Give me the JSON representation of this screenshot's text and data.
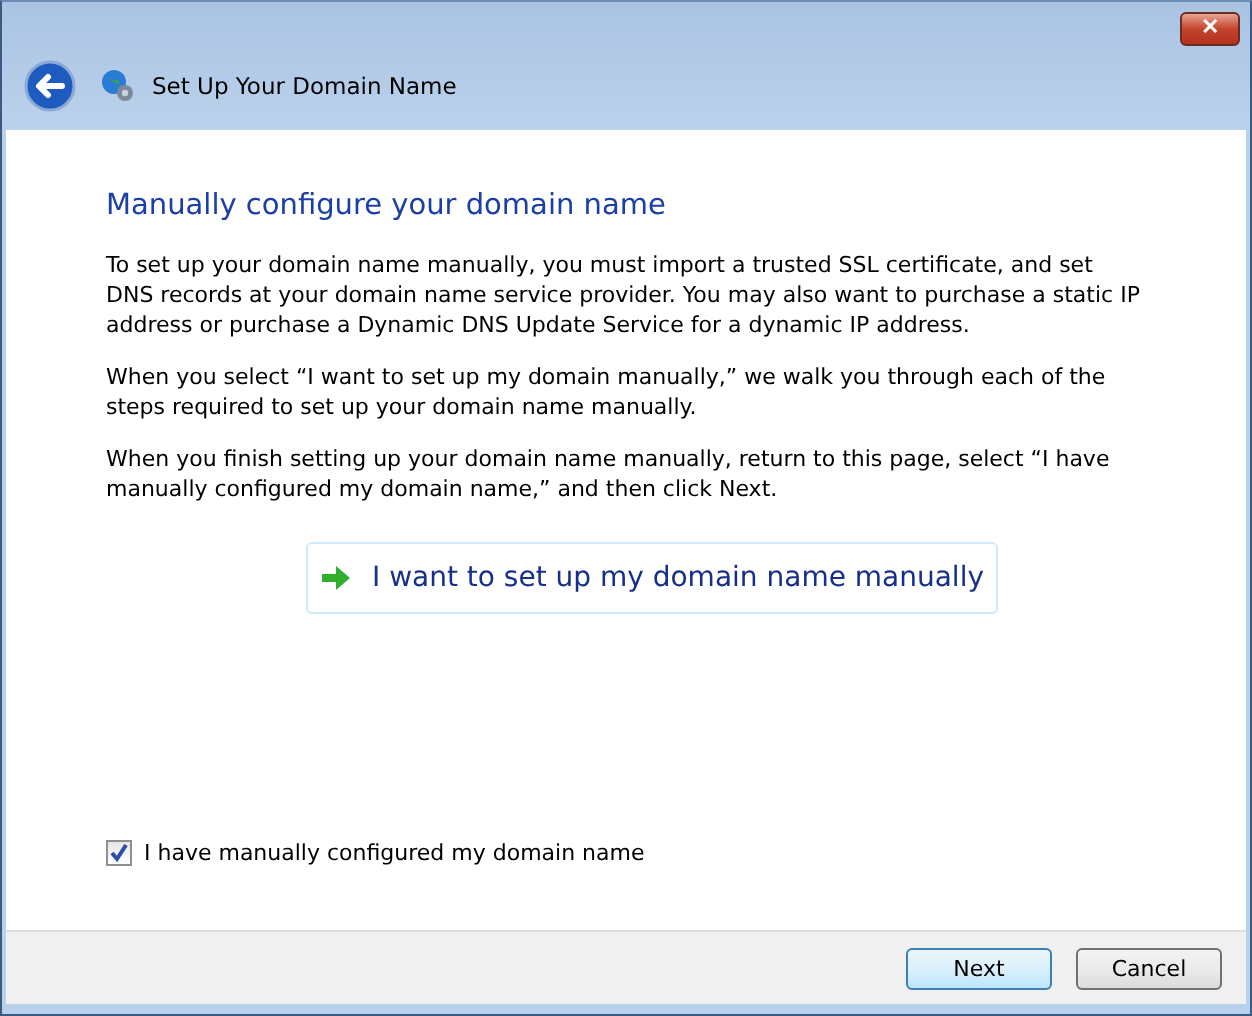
{
  "window": {
    "title": "Set Up Your Domain Name",
    "close_symbol": "✕"
  },
  "heading": "Manually configure your domain name",
  "paragraphs": [
    "To set up your domain name manually, you must import a trusted SSL certificate, and set DNS records at your domain name service provider. You may also want to purchase a static IP address or purchase a Dynamic DNS Update Service for a dynamic IP address.",
    "When you select “I want to set up my domain manually,” we walk you through each of the steps required to set up your domain name manually.",
    "When you finish setting up your domain name manually, return to this page, select “I have manually configured my domain name,” and then click Next."
  ],
  "command_link": {
    "label": "I want to set up my domain name manually"
  },
  "checkbox": {
    "label": "I have manually configured my domain name",
    "checked": true
  },
  "buttons": [
    {
      "label": "Next",
      "default": true
    },
    {
      "label": "Cancel",
      "default": false
    }
  ]
}
